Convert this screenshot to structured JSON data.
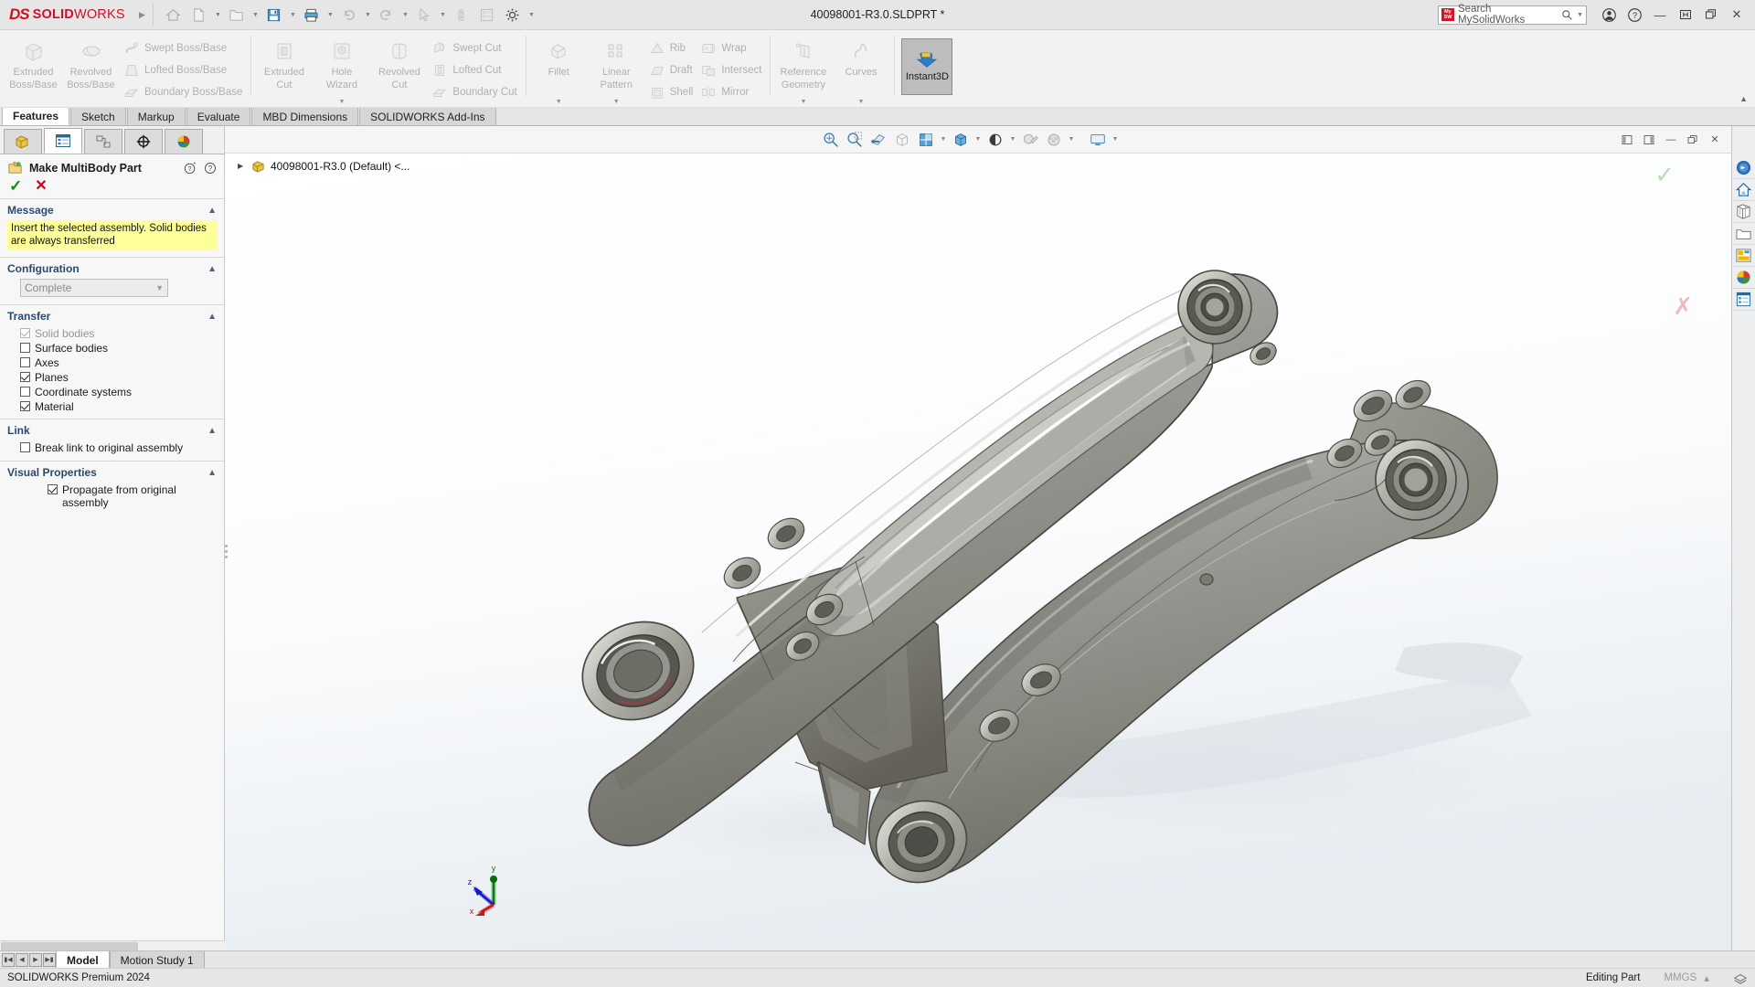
{
  "titlebar": {
    "brand_ds": "DS",
    "brand_bold": "SOLID",
    "brand_normal": "WORKS",
    "document_title": "40098001-R3.0.SLDPRT *",
    "quick_access": [
      {
        "name": "home-icon",
        "label": "Home"
      },
      {
        "name": "new-document-icon",
        "label": "New"
      },
      {
        "name": "open-folder-icon",
        "label": "Open"
      },
      {
        "name": "save-icon",
        "label": "Save"
      },
      {
        "name": "print-icon",
        "label": "Print"
      },
      {
        "name": "undo-icon",
        "label": "Undo"
      },
      {
        "name": "redo-icon",
        "label": "Redo"
      },
      {
        "name": "select-cursor-icon",
        "label": "Select"
      },
      {
        "name": "rebuild-icon",
        "label": "Rebuild"
      },
      {
        "name": "file-properties-icon",
        "label": "File Properties"
      },
      {
        "name": "options-gear-icon",
        "label": "Options"
      }
    ],
    "search": {
      "placeholder": "Search MySolidWorks",
      "badge_line1": "My",
      "badge_line2": "SW"
    },
    "window_buttons": [
      "account-icon",
      "help-icon",
      "minimize-button",
      "restore-button",
      "maximize-button",
      "close-button"
    ]
  },
  "ribbon": {
    "groups": [
      {
        "big": [
          {
            "label_line1": "Extruded",
            "label_line2": "Boss/Base",
            "icon": "extruded-boss-icon"
          },
          {
            "label_line1": "Revolved",
            "label_line2": "Boss/Base",
            "icon": "revolved-boss-icon"
          }
        ],
        "small": [
          {
            "label": "Swept Boss/Base",
            "icon": "swept-boss-icon"
          },
          {
            "label": "Lofted Boss/Base",
            "icon": "lofted-boss-icon"
          },
          {
            "label": "Boundary Boss/Base",
            "icon": "boundary-boss-icon"
          }
        ]
      },
      {
        "big": [
          {
            "label_line1": "Extruded",
            "label_line2": "Cut",
            "icon": "extruded-cut-icon"
          },
          {
            "label_line1": "Hole",
            "label_line2": "Wizard",
            "icon": "hole-wizard-icon",
            "dropdown": true
          },
          {
            "label_line1": "Revolved",
            "label_line2": "Cut",
            "icon": "revolved-cut-icon"
          }
        ],
        "small": [
          {
            "label": "Swept Cut",
            "icon": "swept-cut-icon"
          },
          {
            "label": "Lofted Cut",
            "icon": "lofted-cut-icon"
          },
          {
            "label": "Boundary Cut",
            "icon": "boundary-cut-icon"
          }
        ]
      },
      {
        "big": [
          {
            "label_line1": "Fillet",
            "label_line2": "",
            "icon": "fillet-icon",
            "dropdown": true
          },
          {
            "label_line1": "Linear",
            "label_line2": "Pattern",
            "icon": "linear-pattern-icon",
            "dropdown": true
          }
        ],
        "small": [
          {
            "label": "Rib",
            "icon": "rib-icon"
          },
          {
            "label": "Draft",
            "icon": "draft-icon"
          },
          {
            "label": "Shell",
            "icon": "shell-icon"
          }
        ],
        "small2": [
          {
            "label": "Wrap",
            "icon": "wrap-icon"
          },
          {
            "label": "Intersect",
            "icon": "intersect-icon"
          },
          {
            "label": "Mirror",
            "icon": "mirror-icon"
          }
        ]
      },
      {
        "big": [
          {
            "label_line1": "Reference",
            "label_line2": "Geometry",
            "icon": "reference-geometry-icon",
            "dropdown": true
          },
          {
            "label_line1": "Curves",
            "label_line2": "",
            "icon": "curves-icon",
            "dropdown": true
          }
        ]
      }
    ],
    "instant3d": {
      "label": "Instant3D",
      "icon": "instant3d-icon",
      "active": true
    }
  },
  "command_tabs": [
    {
      "label": "Features",
      "active": true
    },
    {
      "label": "Sketch",
      "active": false
    },
    {
      "label": "Markup",
      "active": false
    },
    {
      "label": "Evaluate",
      "active": false
    },
    {
      "label": "MBD Dimensions",
      "active": false
    },
    {
      "label": "SOLIDWORKS Add-Ins",
      "active": false
    }
  ],
  "property_manager": {
    "tabs": [
      {
        "name": "feature-manager-tab",
        "icon": "feature-tree-icon",
        "active": false
      },
      {
        "name": "property-manager-tab",
        "icon": "property-list-icon",
        "active": true
      },
      {
        "name": "configuration-manager-tab",
        "icon": "configuration-icon",
        "active": false
      },
      {
        "name": "dimxpert-manager-tab",
        "icon": "dimxpert-icon",
        "active": false
      },
      {
        "name": "display-manager-tab",
        "icon": "appearance-sphere-icon",
        "active": false
      }
    ],
    "title": "Make MultiBody Part",
    "title_icon": "make-multibody-part-icon",
    "help_icons": [
      "whats-new-help-icon",
      "help-icon"
    ],
    "confirm": {
      "ok": "✓",
      "cancel": "✕"
    },
    "sections": {
      "message": {
        "title": "Message",
        "text": "Insert the selected assembly. Solid bodies are always transferred"
      },
      "configuration": {
        "title": "Configuration",
        "selected": "Complete",
        "options": [
          "Complete"
        ]
      },
      "transfer": {
        "title": "Transfer",
        "items": [
          {
            "label": "Solid bodies",
            "checked": true,
            "disabled": true
          },
          {
            "label": "Surface bodies",
            "checked": false,
            "disabled": false
          },
          {
            "label": "Axes",
            "checked": false,
            "disabled": false
          },
          {
            "label": "Planes",
            "checked": true,
            "disabled": false
          },
          {
            "label": "Coordinate systems",
            "checked": false,
            "disabled": false
          },
          {
            "label": "Material",
            "checked": true,
            "disabled": false
          }
        ]
      },
      "link": {
        "title": "Link",
        "items": [
          {
            "label": "Break link to original assembly",
            "checked": false,
            "disabled": false
          }
        ]
      },
      "visual_properties": {
        "title": "Visual Properties",
        "items": [
          {
            "label": "Propagate from original assembly",
            "checked": true,
            "disabled": false
          }
        ]
      }
    }
  },
  "viewport": {
    "toolbar": [
      {
        "name": "zoom-to-fit-icon"
      },
      {
        "name": "zoom-to-area-icon"
      },
      {
        "name": "section-view-icon"
      },
      {
        "name": "view-orientation-icon"
      },
      {
        "name": "display-style-icon",
        "dropdown": true
      },
      {
        "name": "hide-show-items-icon",
        "dropdown": true
      },
      {
        "name": "edit-appearance-icon",
        "dropdown": true
      },
      {
        "name": "apply-scene-icon",
        "dropdown": true
      },
      {
        "name": "view-settings-icon",
        "dropdown": true
      }
    ],
    "window_buttons": [
      "dock-left-button",
      "dock-right-button",
      "minimize-button",
      "restore-button",
      "close-button"
    ],
    "tree_root": "40098001-R3.0 (Default) <...",
    "tree_root_icon": "part-yellow-icon",
    "triad": {
      "x": "x",
      "y": "y",
      "z": "z"
    }
  },
  "task_pane": [
    {
      "name": "solidworks-resources-icon",
      "selected": false
    },
    {
      "name": "design-library-home-icon",
      "selected": false
    },
    {
      "name": "file-explorer-icon",
      "selected": false
    },
    {
      "name": "view-palette-icon",
      "selected": false
    },
    {
      "name": "appearances-scenes-icon",
      "selected": false
    },
    {
      "name": "custom-properties-icon",
      "selected": false
    }
  ],
  "bottom": {
    "nav_buttons": [
      "first-tab-button",
      "prev-tab-button",
      "next-tab-button",
      "last-tab-button"
    ],
    "tabs": [
      {
        "label": "Model",
        "active": true
      },
      {
        "label": "Motion Study 1",
        "active": false
      }
    ]
  },
  "status_bar": {
    "left": "SOLIDWORKS Premium 2024",
    "editing": "Editing Part",
    "units": "MMGS",
    "units_caret": "▴",
    "overlay_icon": "overlay-layers-icon"
  }
}
